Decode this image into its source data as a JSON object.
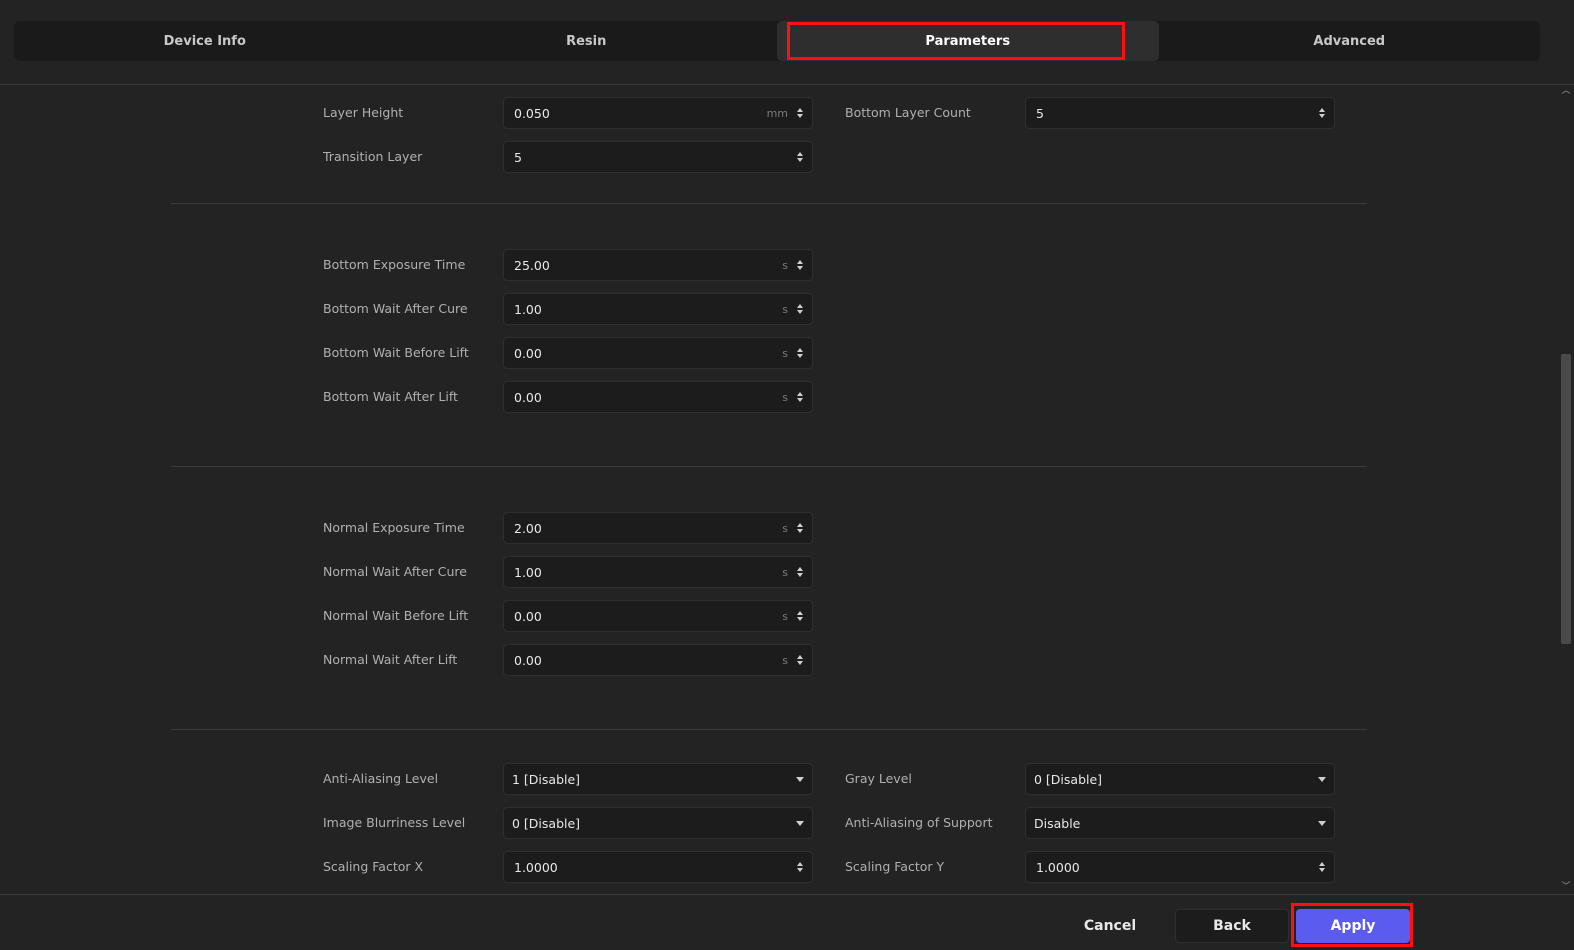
{
  "tabs": [
    {
      "label": "Device Info"
    },
    {
      "label": "Resin"
    },
    {
      "label": "Parameters"
    },
    {
      "label": "Advanced"
    }
  ],
  "fields": {
    "layer_height": {
      "label": "Layer Height",
      "value": "0.050",
      "unit": "mm"
    },
    "bottom_layer_count": {
      "label": "Bottom Layer Count",
      "value": "5"
    },
    "transition_layer": {
      "label": "Transition Layer",
      "value": "5"
    },
    "bottom_exposure_time": {
      "label": "Bottom Exposure Time",
      "value": "25.00",
      "unit": "s"
    },
    "bottom_wait_after_cure": {
      "label": "Bottom Wait After Cure",
      "value": "1.00",
      "unit": "s"
    },
    "bottom_wait_before_lift": {
      "label": "Bottom Wait Before Lift",
      "value": "0.00",
      "unit": "s"
    },
    "bottom_wait_after_lift": {
      "label": "Bottom Wait After Lift",
      "value": "0.00",
      "unit": "s"
    },
    "normal_exposure_time": {
      "label": "Normal Exposure Time",
      "value": "2.00",
      "unit": "s"
    },
    "normal_wait_after_cure": {
      "label": "Normal Wait After Cure",
      "value": "1.00",
      "unit": "s"
    },
    "normal_wait_before_lift": {
      "label": "Normal Wait Before Lift",
      "value": "0.00",
      "unit": "s"
    },
    "normal_wait_after_lift": {
      "label": "Normal Wait After Lift",
      "value": "0.00",
      "unit": "s"
    },
    "anti_aliasing_level": {
      "label": "Anti-Aliasing Level",
      "value": "1 [Disable]"
    },
    "gray_level": {
      "label": "Gray Level",
      "value": "0 [Disable]"
    },
    "image_blurriness_level": {
      "label": "Image Blurriness Level",
      "value": "0 [Disable]"
    },
    "anti_aliasing_of_support": {
      "label": "Anti-Aliasing of Support",
      "value": "Disable"
    },
    "scaling_factor_x": {
      "label": "Scaling Factor X",
      "value": "1.0000"
    },
    "scaling_factor_y": {
      "label": "Scaling Factor Y",
      "value": "1.0000"
    }
  },
  "footer": {
    "cancel_label": "Cancel",
    "back_label": "Back",
    "apply_label": "Apply"
  },
  "colors": {
    "accent": "#5b5bf0",
    "highlight": "#ff1010",
    "background": "#232323"
  }
}
